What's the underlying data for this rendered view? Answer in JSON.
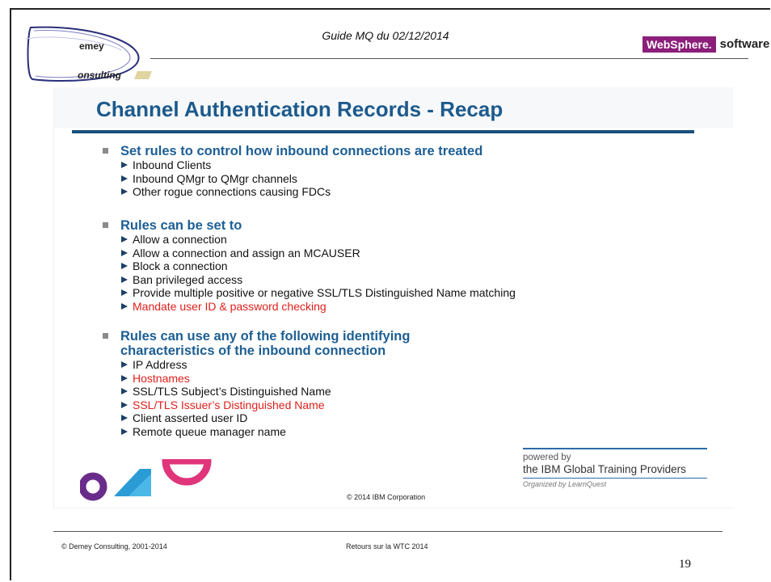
{
  "header": {
    "doc_title": "Guide MQ du 02/12/2014",
    "logo": {
      "top_word": "emey",
      "bottom_word": "onsulting"
    },
    "badge": {
      "brand": "WebSphere.",
      "suffix": "software"
    }
  },
  "slide": {
    "title": "Channel Authentication Records - Recap",
    "sections": [
      {
        "heading": "Set rules to control how inbound connections are treated",
        "items": [
          {
            "text": "Inbound Clients",
            "red": false
          },
          {
            "text": "Inbound QMgr to QMgr channels",
            "red": false
          },
          {
            "text": "Other rogue connections causing FDCs",
            "red": false
          }
        ]
      },
      {
        "heading": "Rules can be set to",
        "items": [
          {
            "text": "Allow a connection",
            "red": false
          },
          {
            "text": "Allow a connection and assign an MCAUSER",
            "red": false
          },
          {
            "text": "Block a connection",
            "red": false
          },
          {
            "text": "Ban privileged access",
            "red": false
          },
          {
            "text": "Provide multiple positive or negative SSL/TLS Distinguished Name matching",
            "red": false
          },
          {
            "text": "Mandate user ID & password checking",
            "red": true
          }
        ]
      },
      {
        "heading_line1": "Rules can use any of the following identifying",
        "heading_line2": "characteristics of the inbound connection",
        "items": [
          {
            "text": "IP Address",
            "red": false
          },
          {
            "text": "Hostnames",
            "red": true
          },
          {
            "text": "SSL/TLS Subject’s Distinguished Name",
            "red": false
          },
          {
            "text": "SSL/TLS Issuer’s Distinguished Name",
            "red": true
          },
          {
            "text": "Client asserted user ID",
            "red": false
          },
          {
            "text": "Remote queue manager name",
            "red": false
          }
        ]
      }
    ],
    "copyright": "© 2014 IBM Corporation",
    "powered": {
      "line1": "powered by",
      "line2": "the IBM Global Training Providers",
      "line3": "Organized by LearnQuest"
    }
  },
  "footer": {
    "left": "© Demey Consulting, 2001-2014",
    "middle": "Retours sur la WTC 2014",
    "page_number": "19"
  },
  "colors": {
    "title_blue": "#1d5a8c",
    "heading_blue": "#1d5f94",
    "highlight_red": "#e0201b",
    "websphere_purple": "#8b1f7a"
  }
}
